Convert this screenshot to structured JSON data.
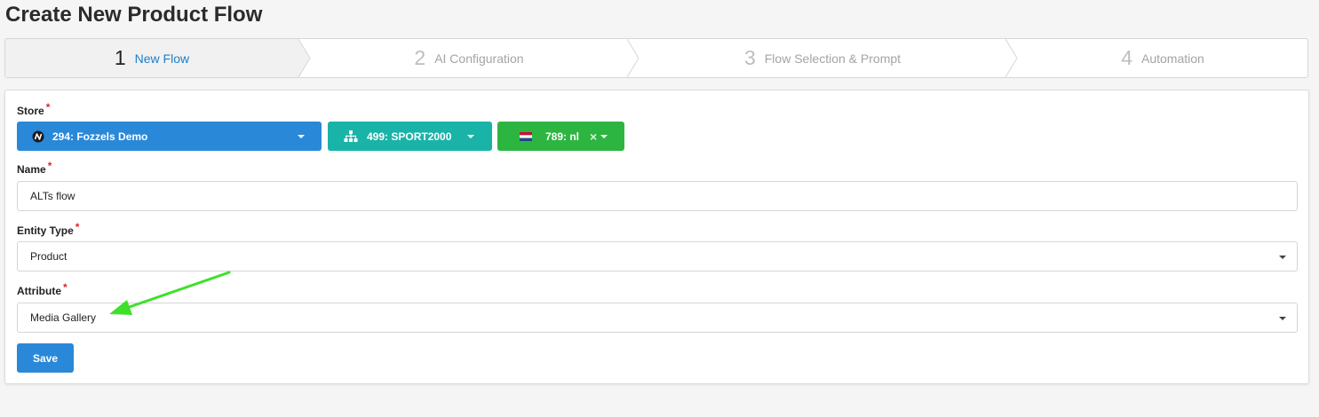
{
  "page": {
    "title": "Create New Product Flow"
  },
  "wizard": {
    "steps": [
      {
        "num": "1",
        "label": "New Flow",
        "active": true
      },
      {
        "num": "2",
        "label": "AI Configuration",
        "active": false
      },
      {
        "num": "3",
        "label": "Flow Selection & Prompt",
        "active": false
      },
      {
        "num": "4",
        "label": "Automation",
        "active": false
      }
    ]
  },
  "form": {
    "store": {
      "label": "Store",
      "required": "*",
      "store_value": "294: Fozzels Demo",
      "channel_value": "499: SPORT2000",
      "locale_value": "789: nl",
      "locale_clear": "×"
    },
    "name": {
      "label": "Name",
      "required": "*",
      "value": "ALTs flow"
    },
    "entity_type": {
      "label": "Entity Type",
      "required": "*",
      "value": "Product"
    },
    "attribute": {
      "label": "Attribute",
      "required": "*",
      "value": "Media Gallery"
    },
    "save_label": "Save"
  },
  "colors": {
    "store_btn": "#2a88d8",
    "channel_btn": "#1ab3a8",
    "locale_btn": "#2db541",
    "accent": "#1e7ec8",
    "annotation_arrow": "#3ee02a"
  },
  "icons": {
    "store": "store-logo-icon",
    "channel": "sitemap-icon",
    "locale": "netherlands-flag-icon"
  }
}
